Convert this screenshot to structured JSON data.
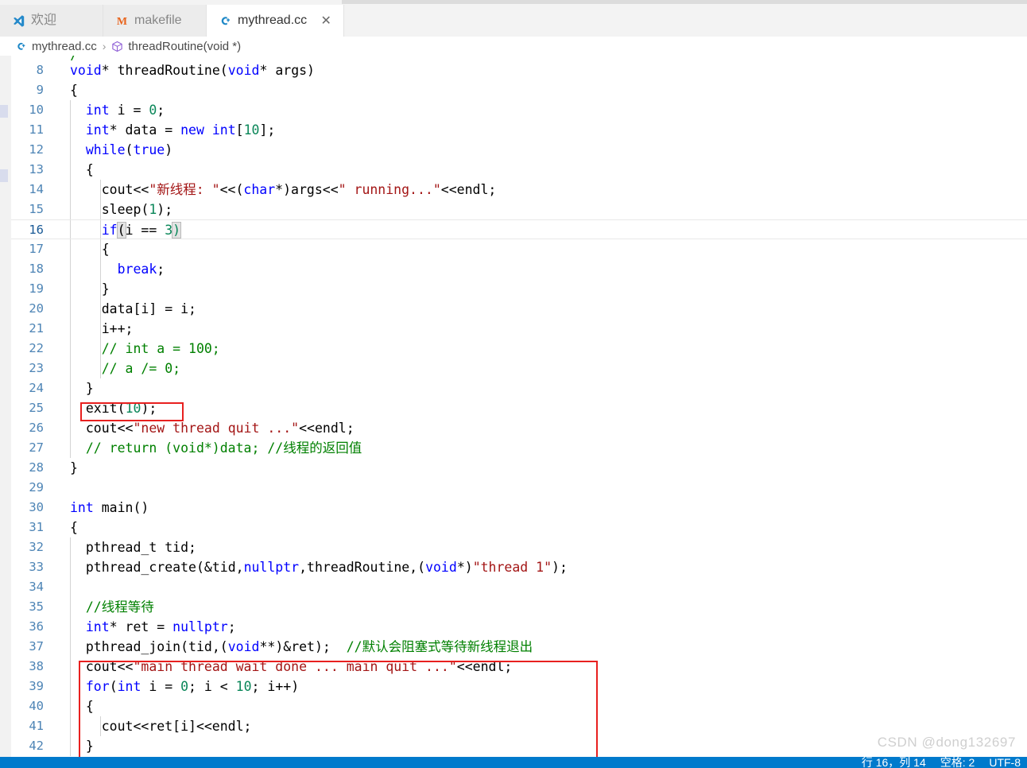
{
  "window": {
    "app": "Visual Studio Code"
  },
  "tabs": [
    {
      "label": "欢迎",
      "icon": "vscode-logo-icon",
      "active": false,
      "closable": false
    },
    {
      "label": "makefile",
      "icon": "makefile-m-icon",
      "active": false,
      "closable": false
    },
    {
      "label": "mythread.cc",
      "icon": "cpp-file-icon",
      "active": true,
      "closable": true,
      "close_label": "✕"
    }
  ],
  "breadcrumb": {
    "items": [
      {
        "label": "mythread.cc",
        "icon": "cpp-file-icon"
      },
      {
        "label": "threadRoutine(void *)",
        "icon": "symbol-cube-icon"
      }
    ],
    "separator": "›"
  },
  "editor": {
    "active_line": 16,
    "first_visible_line": 8,
    "partial_top_line": {
      "number": 7,
      "text": "/"
    },
    "lines": [
      {
        "n": 8,
        "text": "void* threadRoutine(void* args)"
      },
      {
        "n": 9,
        "text": "{"
      },
      {
        "n": 10,
        "text": "  int i = 0;"
      },
      {
        "n": 11,
        "text": "  int* data = new int[10];"
      },
      {
        "n": 12,
        "text": "  while(true)"
      },
      {
        "n": 13,
        "text": "  {"
      },
      {
        "n": 14,
        "text": "    cout<<\"新线程: \"<<(char*)args<<\" running...\"<<endl;"
      },
      {
        "n": 15,
        "text": "    sleep(1);"
      },
      {
        "n": 16,
        "text": "    if(i == 3)"
      },
      {
        "n": 17,
        "text": "    {"
      },
      {
        "n": 18,
        "text": "      break;"
      },
      {
        "n": 19,
        "text": "    }"
      },
      {
        "n": 20,
        "text": "    data[i] = i;"
      },
      {
        "n": 21,
        "text": "    i++;"
      },
      {
        "n": 22,
        "text": "    // int a = 100;"
      },
      {
        "n": 23,
        "text": "    // a /= 0;"
      },
      {
        "n": 24,
        "text": "  }"
      },
      {
        "n": 25,
        "text": "  exit(10);"
      },
      {
        "n": 26,
        "text": "  cout<<\"new thread quit ...\"<<endl;"
      },
      {
        "n": 27,
        "text": "  // return (void*)data; //线程的返回值"
      },
      {
        "n": 28,
        "text": "}"
      },
      {
        "n": 29,
        "text": ""
      },
      {
        "n": 30,
        "text": "int main()"
      },
      {
        "n": 31,
        "text": "{"
      },
      {
        "n": 32,
        "text": "  pthread_t tid;"
      },
      {
        "n": 33,
        "text": "  pthread_create(&tid,nullptr,threadRoutine,(void*)\"thread 1\");"
      },
      {
        "n": 34,
        "text": ""
      },
      {
        "n": 35,
        "text": "  //线程等待"
      },
      {
        "n": 36,
        "text": "  int* ret = nullptr;"
      },
      {
        "n": 37,
        "text": "  pthread_join(tid,(void**)&ret);  //默认会阻塞式等待新线程退出"
      },
      {
        "n": 38,
        "text": "  cout<<\"main thread wait done ... main quit ...\"<<endl;"
      },
      {
        "n": 39,
        "text": "  for(int i = 0; i < 10; i++)"
      },
      {
        "n": 40,
        "text": "  {"
      },
      {
        "n": 41,
        "text": "    cout<<ret[i]<<endl;"
      },
      {
        "n": 42,
        "text": "  }"
      }
    ]
  },
  "annotations": [
    {
      "name": "exit-call-highlight",
      "target_line": 25,
      "target_text": "exit(10);",
      "color": "#e8201f"
    },
    {
      "name": "main-loop-highlight",
      "target_lines": "38-42",
      "color": "#e8201f"
    }
  ],
  "watermark": {
    "text": "CSDN @dong132697"
  },
  "statusbar": {
    "line_col": "行 16，列 14",
    "indent": "空格: 2",
    "encoding": "UTF-8",
    "accent": "#007acc"
  }
}
